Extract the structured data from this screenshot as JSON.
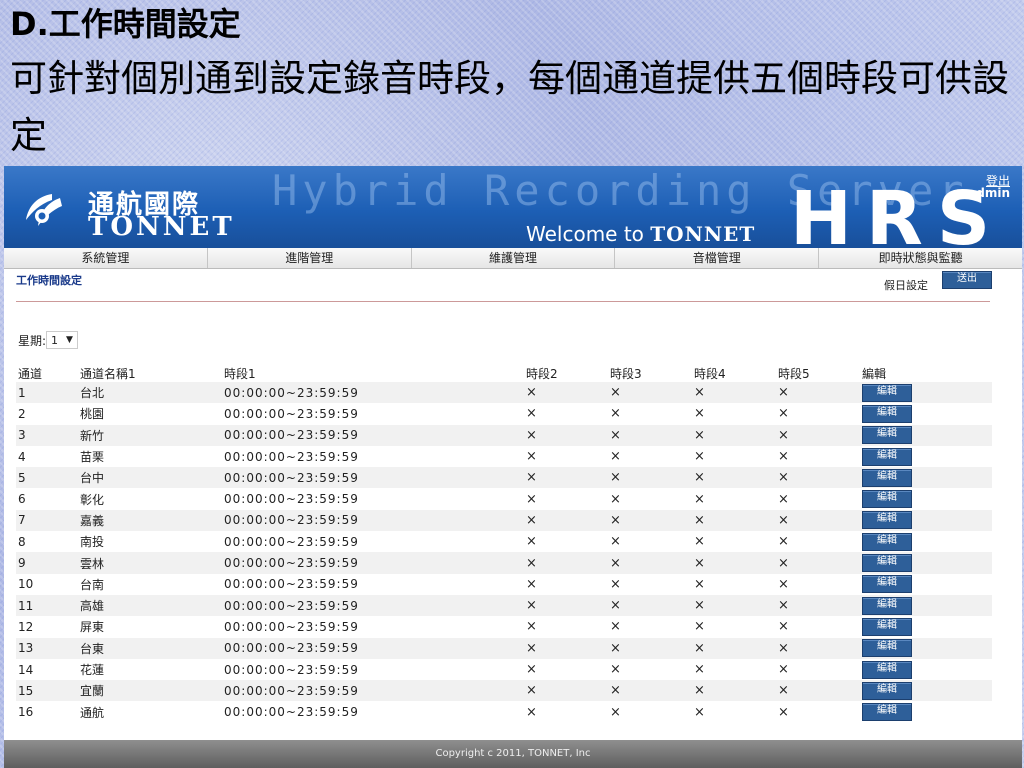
{
  "slide": {
    "title": "D.工作時間設定",
    "description": "可針對個別通到設定錄音時段，每個通道提供五個時段可供設定"
  },
  "header": {
    "logo_cn": "通航國際",
    "logo_en": "TONNET",
    "hybrid": "Hybrid Recording Server",
    "welcome_prefix": "Welcome to ",
    "welcome_brand": "TONNET",
    "hrs": "HRS",
    "logout": "登出",
    "user": "admin"
  },
  "nav": {
    "items": [
      "系統管理",
      "進階管理",
      "維護管理",
      "音檔管理",
      "即時狀態與監聽"
    ]
  },
  "page": {
    "title": "工作時間設定",
    "holiday_label": "假日設定",
    "holiday_button": "送出",
    "weekday_label": "星期:",
    "weekday_value": "1"
  },
  "table": {
    "headers": [
      "通道",
      "通道名稱1",
      "時段1",
      "時段2",
      "時段3",
      "時段4",
      "時段5",
      "編輯"
    ],
    "edit_label": "編輯",
    "rows": [
      {
        "ch": "1",
        "name": "台北",
        "s1": "00:00:00~23:59:59",
        "s2": "×",
        "s3": "×",
        "s4": "×",
        "s5": "×"
      },
      {
        "ch": "2",
        "name": "桃園",
        "s1": "00:00:00~23:59:59",
        "s2": "×",
        "s3": "×",
        "s4": "×",
        "s5": "×"
      },
      {
        "ch": "3",
        "name": "新竹",
        "s1": "00:00:00~23:59:59",
        "s2": "×",
        "s3": "×",
        "s4": "×",
        "s5": "×"
      },
      {
        "ch": "4",
        "name": "苗栗",
        "s1": "00:00:00~23:59:59",
        "s2": "×",
        "s3": "×",
        "s4": "×",
        "s5": "×"
      },
      {
        "ch": "5",
        "name": "台中",
        "s1": "00:00:00~23:59:59",
        "s2": "×",
        "s3": "×",
        "s4": "×",
        "s5": "×"
      },
      {
        "ch": "6",
        "name": "彰化",
        "s1": "00:00:00~23:59:59",
        "s2": "×",
        "s3": "×",
        "s4": "×",
        "s5": "×"
      },
      {
        "ch": "7",
        "name": "嘉義",
        "s1": "00:00:00~23:59:59",
        "s2": "×",
        "s3": "×",
        "s4": "×",
        "s5": "×"
      },
      {
        "ch": "8",
        "name": "南投",
        "s1": "00:00:00~23:59:59",
        "s2": "×",
        "s3": "×",
        "s4": "×",
        "s5": "×"
      },
      {
        "ch": "9",
        "name": "雲林",
        "s1": "00:00:00~23:59:59",
        "s2": "×",
        "s3": "×",
        "s4": "×",
        "s5": "×"
      },
      {
        "ch": "10",
        "name": "台南",
        "s1": "00:00:00~23:59:59",
        "s2": "×",
        "s3": "×",
        "s4": "×",
        "s5": "×"
      },
      {
        "ch": "11",
        "name": "高雄",
        "s1": "00:00:00~23:59:59",
        "s2": "×",
        "s3": "×",
        "s4": "×",
        "s5": "×"
      },
      {
        "ch": "12",
        "name": "屏東",
        "s1": "00:00:00~23:59:59",
        "s2": "×",
        "s3": "×",
        "s4": "×",
        "s5": "×"
      },
      {
        "ch": "13",
        "name": "台東",
        "s1": "00:00:00~23:59:59",
        "s2": "×",
        "s3": "×",
        "s4": "×",
        "s5": "×"
      },
      {
        "ch": "14",
        "name": "花蓮",
        "s1": "00:00:00~23:59:59",
        "s2": "×",
        "s3": "×",
        "s4": "×",
        "s5": "×"
      },
      {
        "ch": "15",
        "name": "宜蘭",
        "s1": "00:00:00~23:59:59",
        "s2": "×",
        "s3": "×",
        "s4": "×",
        "s5": "×"
      },
      {
        "ch": "16",
        "name": "通航",
        "s1": "00:00:00~23:59:59",
        "s2": "×",
        "s3": "×",
        "s4": "×",
        "s5": "×"
      }
    ]
  },
  "footer": {
    "text": "Copyright c 2011, TONNET, Inc"
  },
  "colors": {
    "header_blue": "#1d5fb5",
    "button_blue": "#2e5f99",
    "title_blue": "#1a3a8a"
  }
}
